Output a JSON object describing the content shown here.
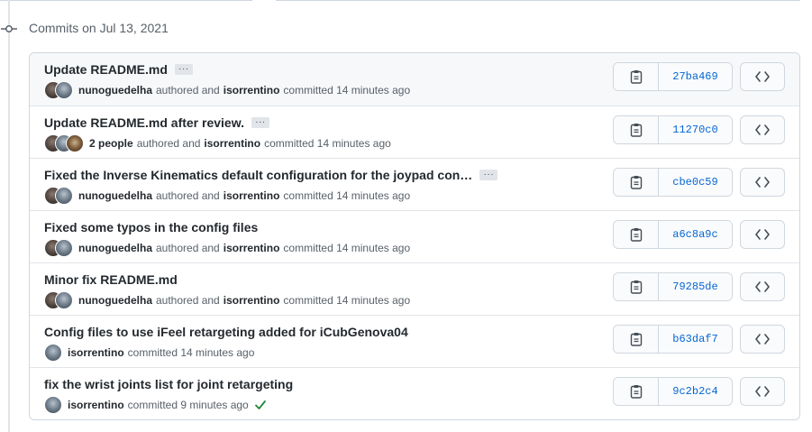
{
  "group": {
    "header": "Commits on Jul 13, 2021"
  },
  "commits": [
    {
      "title": "Update README.md",
      "has_ellipsis": true,
      "avatars": 2,
      "author": "nunoguedelha",
      "authored": "authored and",
      "committer": "isorrentino",
      "committed": "committed 14 minutes ago",
      "sha": "27ba469",
      "verified": false
    },
    {
      "title": "Update README.md after review.",
      "has_ellipsis": true,
      "avatars": 3,
      "author": "2 people",
      "authored": "authored and",
      "committer": "isorrentino",
      "committed": "committed 14 minutes ago",
      "sha": "11270c0",
      "verified": false
    },
    {
      "title": "Fixed the Inverse Kinematics default configuration for the joypad con…",
      "has_ellipsis": true,
      "avatars": 2,
      "author": "nunoguedelha",
      "authored": "authored and",
      "committer": "isorrentino",
      "committed": "committed 14 minutes ago",
      "sha": "cbe0c59",
      "verified": false
    },
    {
      "title": "Fixed some typos in the config files",
      "has_ellipsis": false,
      "avatars": 2,
      "author": "nunoguedelha",
      "authored": "authored and",
      "committer": "isorrentino",
      "committed": "committed 14 minutes ago",
      "sha": "a6c8a9c",
      "verified": false
    },
    {
      "title": "Minor fix README.md",
      "has_ellipsis": false,
      "avatars": 2,
      "author": "nunoguedelha",
      "authored": "authored and",
      "committer": "isorrentino",
      "committed": "committed 14 minutes ago",
      "sha": "79285de",
      "verified": false
    },
    {
      "title": "Config files to use iFeel retargeting added for iCubGenova04",
      "has_ellipsis": false,
      "avatars": 1,
      "author": "isorrentino",
      "authored": "",
      "committer": "",
      "committed": "committed 14 minutes ago",
      "sha": "b63daf7",
      "verified": false
    },
    {
      "title": "fix the wrist joints list for joint retargeting",
      "has_ellipsis": false,
      "avatars": 1,
      "author": "isorrentino",
      "authored": "",
      "committer": "",
      "committed": "committed 9 minutes ago",
      "sha": "9c2b2c4",
      "verified": true
    }
  ],
  "icons": {
    "copy": "clipboard-icon",
    "browse": "code-icon",
    "verified": "check-icon",
    "ellipsis": "ellipsis-icon",
    "timeline": "commit-node-icon"
  },
  "colors": {
    "sha_link": "#0366d6",
    "check": "#22863a",
    "border": "#d0d7de"
  }
}
